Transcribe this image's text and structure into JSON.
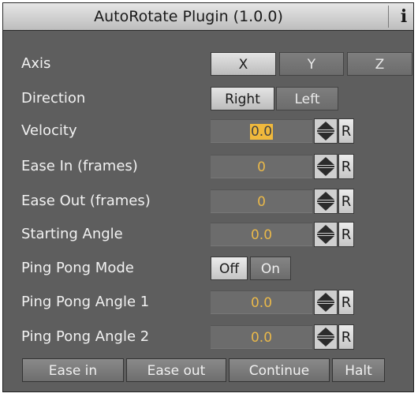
{
  "window": {
    "title": "AutoRotate Plugin (1.0.0)",
    "info_label": "i"
  },
  "axis": {
    "label": "Axis",
    "options": [
      "X",
      "Y",
      "Z"
    ],
    "selected": "X"
  },
  "direction": {
    "label": "Direction",
    "options": [
      "Right",
      "Left"
    ],
    "selected": "Right"
  },
  "fields": [
    {
      "label": "Velocity",
      "value": "0.0",
      "reset": "R"
    },
    {
      "label": "Ease In (frames)",
      "value": "0",
      "reset": "R"
    },
    {
      "label": "Ease Out (frames)",
      "value": "0",
      "reset": "R"
    },
    {
      "label": "Starting Angle",
      "value": "0.0",
      "reset": "R"
    }
  ],
  "ping_pong": {
    "label": "Ping Pong Mode",
    "options": [
      "Off",
      "On"
    ],
    "selected": "Off"
  },
  "angles": [
    {
      "label": "Ping Pong Angle 1",
      "value": "0.0",
      "reset": "R"
    },
    {
      "label": "Ping Pong Angle 2",
      "value": "0.0",
      "reset": "R"
    }
  ],
  "bottom_buttons": [
    "Ease in",
    "Ease out",
    "Continue",
    "Halt"
  ],
  "colors": {
    "panel": "#5e5e5e",
    "value_text": "#e9b84a",
    "selection": "#f0b93c"
  }
}
